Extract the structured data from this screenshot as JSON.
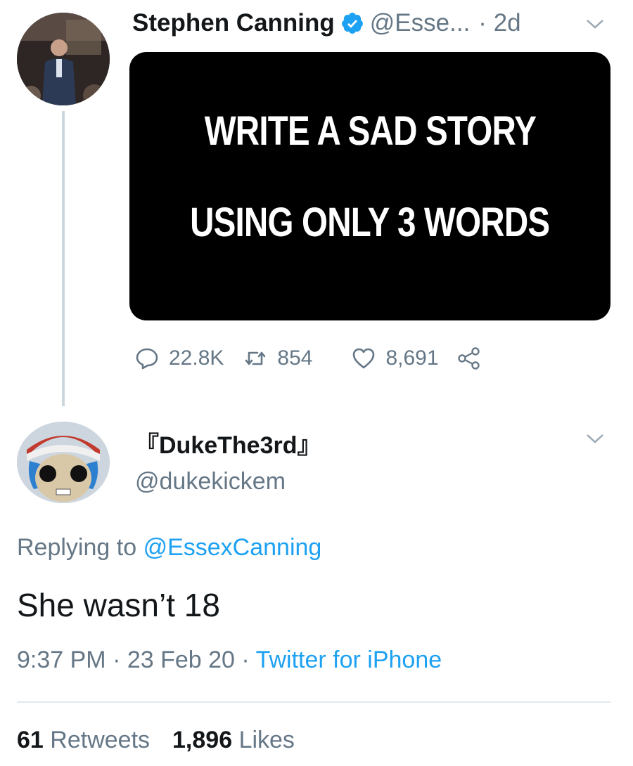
{
  "original_tweet": {
    "author_name": "Stephen Canning",
    "handle": "@Esse...",
    "time_sep": "·",
    "time": "2d",
    "media_lines": [
      "WRITE A SAD STORY",
      "USING ONLY 3 WORDS"
    ],
    "replies": "22.8K",
    "retweets": "854",
    "likes": "8,691"
  },
  "reply_tweet": {
    "author_name": "『DukeThe3rd』",
    "handle": "@dukekickem",
    "replying_prefix": "Replying to",
    "replying_handle": "@EssexCanning",
    "text": "She wasn’t 18",
    "timestamp": "9:37 PM · 23 Feb 20 ·",
    "source": "Twitter for iPhone",
    "retweet_count": "61",
    "retweet_label": "Retweets",
    "like_count": "1,896",
    "like_label": "Likes"
  },
  "colors": {
    "link_blue": "#1da1f2",
    "secondary_text": "#657786",
    "primary_text": "#14171a",
    "divider": "#e1e8ed"
  },
  "icons": [
    "verified-badge-icon",
    "chevron-down-icon",
    "reply-icon",
    "retweet-icon",
    "like-icon",
    "share-icon"
  ]
}
